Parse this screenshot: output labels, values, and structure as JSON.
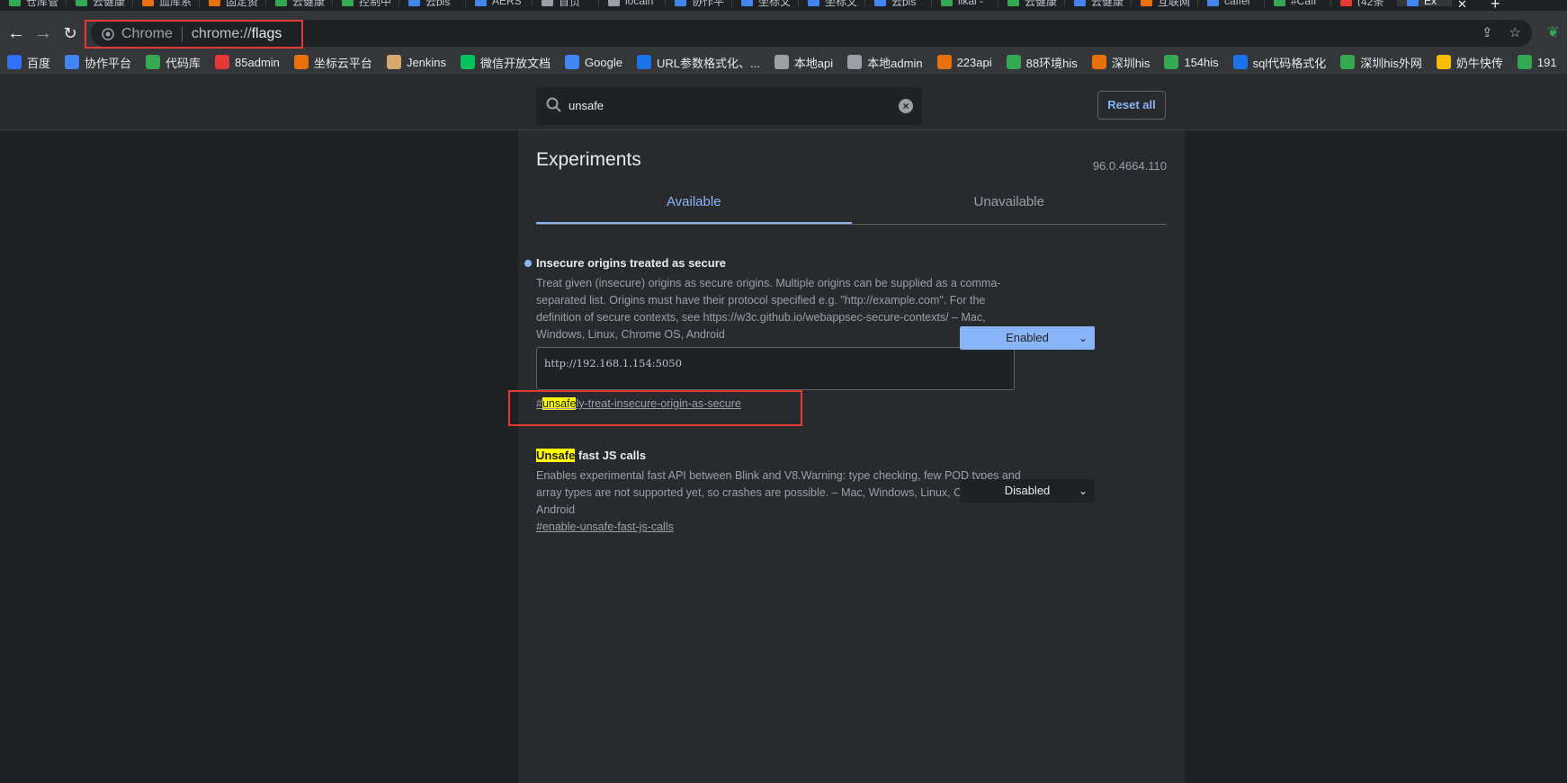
{
  "tabs": [
    {
      "label": "仓库管",
      "color": "#34a853"
    },
    {
      "label": "云健康",
      "color": "#34a853"
    },
    {
      "label": "血库系",
      "color": "#e8710a"
    },
    {
      "label": "固定资",
      "color": "#e8710a"
    },
    {
      "label": "云健康",
      "color": "#34a853"
    },
    {
      "label": "控制中",
      "color": "#34a853"
    },
    {
      "label": "云pis",
      "color": "#4285f4"
    },
    {
      "label": "AERS",
      "color": "#4285f4"
    },
    {
      "label": "首页",
      "color": "#9aa0a6"
    },
    {
      "label": "localh",
      "color": "#9aa0a6"
    },
    {
      "label": "协作平",
      "color": "#4285f4"
    },
    {
      "label": "坐标文",
      "color": "#4285f4"
    },
    {
      "label": "坐标文",
      "color": "#4285f4"
    },
    {
      "label": "云pis",
      "color": "#4285f4"
    },
    {
      "label": "likai -",
      "color": "#34a853"
    },
    {
      "label": "云健康",
      "color": "#34a853"
    },
    {
      "label": "云健康",
      "color": "#4285f4"
    },
    {
      "label": "互联网",
      "color": "#e8710a"
    },
    {
      "label": "caffei",
      "color": "#4285f4"
    },
    {
      "label": "#Caff",
      "color": "#34a853"
    },
    {
      "label": "(42条",
      "color": "#e53935"
    },
    {
      "label": "Ex",
      "color": "#4285f4",
      "active": true
    }
  ],
  "toolbar": {
    "back_icon": "back-arrow-icon",
    "forward_icon": "forward-arrow-icon",
    "reload_icon": "reload-icon"
  },
  "omnibox": {
    "site_label": "Chrome",
    "url_scheme": "chrome://",
    "url_host": "flags"
  },
  "bookmarks": [
    {
      "label": "百度",
      "color": "#3370ff"
    },
    {
      "label": "协作平台",
      "color": "#4285f4"
    },
    {
      "label": "代码库",
      "color": "#34a853"
    },
    {
      "label": "85admin",
      "color": "#e53935"
    },
    {
      "label": "坐标云平台",
      "color": "#e8710a"
    },
    {
      "label": "Jenkins",
      "color": "#d7a86e"
    },
    {
      "label": "微信开放文档",
      "color": "#07c160"
    },
    {
      "label": "Google",
      "color": "#4285f4"
    },
    {
      "label": "URL参数格式化、...",
      "color": "#1a73e8"
    },
    {
      "label": "本地api",
      "color": "#9aa0a6"
    },
    {
      "label": "本地admin",
      "color": "#9aa0a6"
    },
    {
      "label": "223api",
      "color": "#e8710a"
    },
    {
      "label": "88环境his",
      "color": "#34a853"
    },
    {
      "label": "深圳his",
      "color": "#e8710a"
    },
    {
      "label": "154his",
      "color": "#34a853"
    },
    {
      "label": "sql代码格式化",
      "color": "#1a73e8"
    },
    {
      "label": "深圳his外网",
      "color": "#34a853"
    },
    {
      "label": "奶牛快传",
      "color": "#fbbc04"
    },
    {
      "label": "191",
      "color": "#34a853"
    }
  ],
  "search": {
    "query": "unsafe",
    "reset_label": "Reset all"
  },
  "experiments": {
    "title": "Experiments",
    "version": "96.0.4664.110",
    "tab_available": "Available",
    "tab_unavailable": "Unavailable"
  },
  "flags": [
    {
      "title": "Insecure origins treated as secure",
      "description": "Treat given (insecure) origins as secure origins. Multiple origins can be supplied as a comma-separated list. Origins must have their protocol specified e.g. \"http://example.com\". For the definition of secure contexts, see https://w3c.github.io/webappsec-secure-contexts/ – Mac, Windows, Linux, Chrome OS, Android",
      "input_value": "http://192.168.1.154:5050",
      "link_prefix": "#",
      "link_highlight": "unsafe",
      "link_suffix": "ly-treat-insecure-origin-as-secure",
      "select_value": "Enabled"
    },
    {
      "title_highlight": "Unsafe",
      "title_rest": " fast JS calls",
      "description": "Enables experimental fast API between Blink and V8.Warning: type checking, few POD types and array types are not supported yet, so crashes are possible. – Mac, Windows, Linux, Chrome OS, Android",
      "link": "#enable-unsafe-fast-js-calls",
      "select_value": "Disabled"
    }
  ]
}
